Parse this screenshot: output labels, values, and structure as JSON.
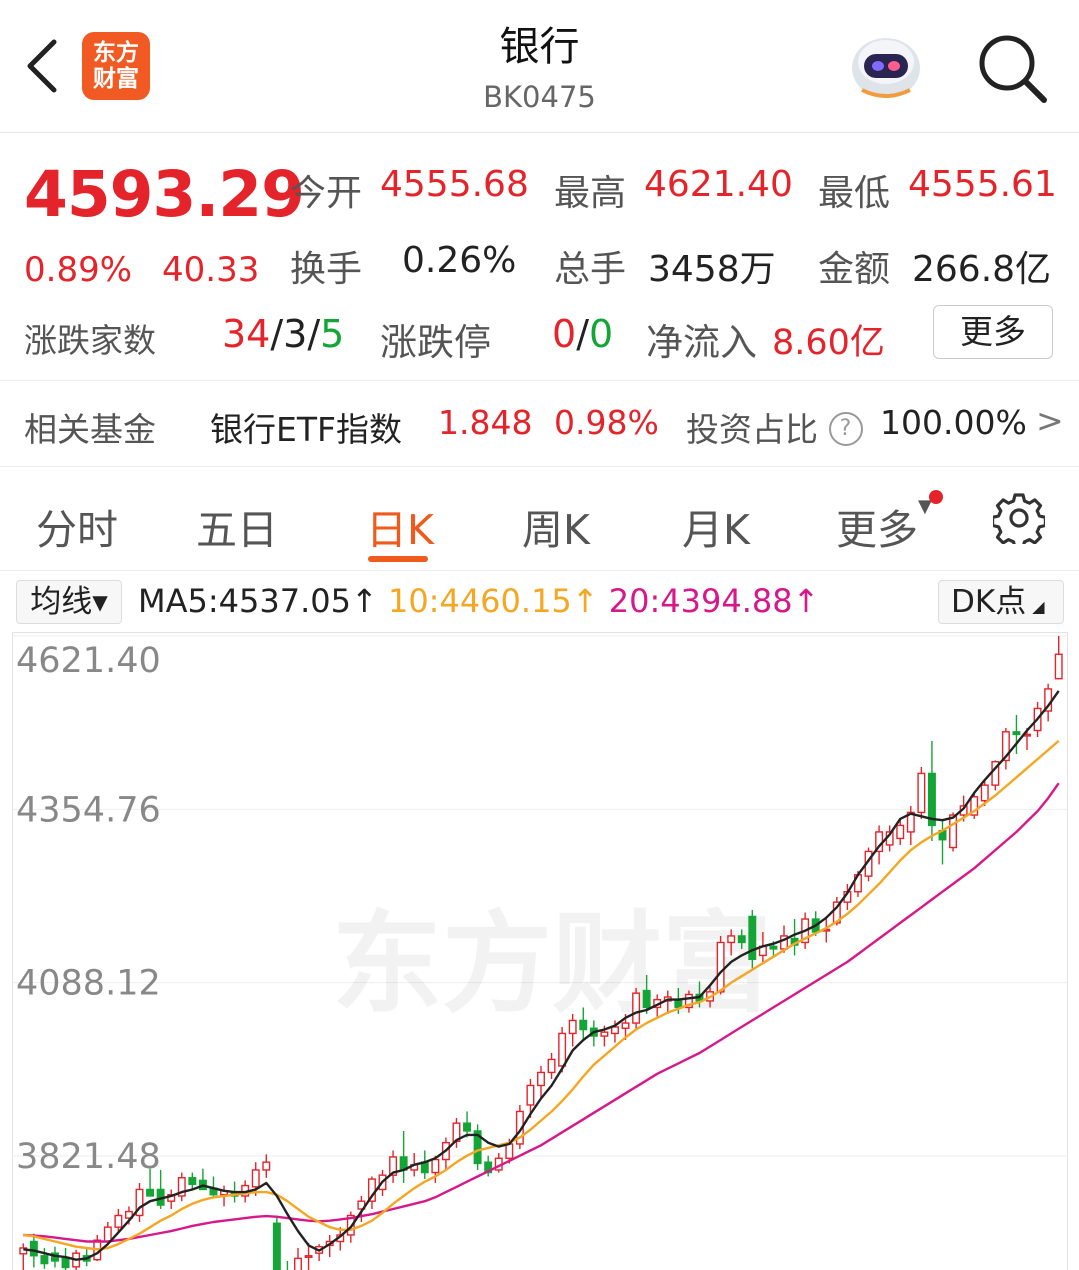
{
  "header": {
    "title": "银行",
    "subtitle": "BK0475",
    "logo_line1": "东方",
    "logo_line2": "财富",
    "icons": [
      "back-icon",
      "robot-avatar-icon",
      "search-icon"
    ]
  },
  "quote": {
    "price": "4593.29",
    "change_pct": "0.89%",
    "change_abs": "40.33",
    "open_label": "今开",
    "open": "4555.68",
    "high_label": "最高",
    "high": "4621.40",
    "low_label": "最低",
    "low": "4555.61",
    "turnover_label": "换手",
    "turnover": "0.26%",
    "volume_label": "总手",
    "volume": "3458万",
    "amount_label": "金额",
    "amount": "266.8亿",
    "breadth_label": "涨跌家数",
    "breadth_up": "34",
    "breadth_flat": "3",
    "breadth_down": "5",
    "slash": "/",
    "limit_label": "涨跌停",
    "limit_up": "0",
    "limit_down": "0",
    "inflow_label": "净流入",
    "inflow": "8.60亿",
    "more_label": "更多"
  },
  "fund": {
    "label": "相关基金",
    "name": "银行ETF指数",
    "value": "1.848",
    "pct": "0.98%",
    "ratio_label": "投资占比",
    "help": "?",
    "ratio": "100.00%",
    "arrow": ">"
  },
  "tabs": [
    {
      "label": "分时"
    },
    {
      "label": "五日"
    },
    {
      "label": "日K"
    },
    {
      "label": "周K"
    },
    {
      "label": "月K"
    },
    {
      "label": "更多"
    }
  ],
  "active_tab": "日K",
  "indicator": {
    "ma_button": "均线▾",
    "ma5": "MA5:4537.05↑",
    "ma10": "10:4460.15↑",
    "ma20": "20:4394.88↑",
    "dk_button": "DK点",
    "colors": {
      "ma5": "#222222",
      "ma10": "#f5a623",
      "ma20": "#d6188a",
      "up": "#e4232a",
      "down": "#14a537"
    }
  },
  "watermark": "东方财富",
  "chart_data": {
    "type": "candlestick",
    "y_ticks": [
      "4621.40",
      "4354.76",
      "4088.12",
      "3821.48"
    ],
    "ylim": [
      3660,
      4621.4
    ],
    "grid": true,
    "candles": [
      {
        "o": 3671,
        "h": 3687,
        "l": 3643,
        "c": 3680
      },
      {
        "o": 3690,
        "h": 3702,
        "l": 3650,
        "c": 3668
      },
      {
        "o": 3668,
        "h": 3680,
        "l": 3648,
        "c": 3656
      },
      {
        "o": 3672,
        "h": 3682,
        "l": 3650,
        "c": 3660
      },
      {
        "o": 3664,
        "h": 3680,
        "l": 3642,
        "c": 3650
      },
      {
        "o": 3651,
        "h": 3677,
        "l": 3644,
        "c": 3672
      },
      {
        "o": 3668,
        "h": 3678,
        "l": 3652,
        "c": 3660
      },
      {
        "o": 3662,
        "h": 3700,
        "l": 3660,
        "c": 3692
      },
      {
        "o": 3690,
        "h": 3720,
        "l": 3684,
        "c": 3712
      },
      {
        "o": 3712,
        "h": 3740,
        "l": 3704,
        "c": 3730
      },
      {
        "o": 3726,
        "h": 3744,
        "l": 3716,
        "c": 3736
      },
      {
        "o": 3730,
        "h": 3780,
        "l": 3720,
        "c": 3770
      },
      {
        "o": 3770,
        "h": 3802,
        "l": 3760,
        "c": 3760
      },
      {
        "o": 3770,
        "h": 3800,
        "l": 3740,
        "c": 3746
      },
      {
        "o": 3752,
        "h": 3770,
        "l": 3740,
        "c": 3762
      },
      {
        "o": 3760,
        "h": 3796,
        "l": 3752,
        "c": 3788
      },
      {
        "o": 3788,
        "h": 3796,
        "l": 3770,
        "c": 3778
      },
      {
        "o": 3784,
        "h": 3802,
        "l": 3772,
        "c": 3770
      },
      {
        "o": 3772,
        "h": 3790,
        "l": 3756,
        "c": 3762
      },
      {
        "o": 3762,
        "h": 3776,
        "l": 3744,
        "c": 3768
      },
      {
        "o": 3766,
        "h": 3782,
        "l": 3750,
        "c": 3760
      },
      {
        "o": 3760,
        "h": 3784,
        "l": 3750,
        "c": 3776
      },
      {
        "o": 3774,
        "h": 3812,
        "l": 3760,
        "c": 3800
      },
      {
        "o": 3800,
        "h": 3824,
        "l": 3788,
        "c": 3812
      },
      {
        "o": 3718,
        "h": 3730,
        "l": 3610,
        "c": 3630
      },
      {
        "o": 3640,
        "h": 3660,
        "l": 3600,
        "c": 3620
      },
      {
        "o": 3630,
        "h": 3680,
        "l": 3630,
        "c": 3664
      },
      {
        "o": 3666,
        "h": 3688,
        "l": 3640,
        "c": 3668
      },
      {
        "o": 3672,
        "h": 3686,
        "l": 3660,
        "c": 3682
      },
      {
        "o": 3684,
        "h": 3700,
        "l": 3666,
        "c": 3690
      },
      {
        "o": 3690,
        "h": 3712,
        "l": 3676,
        "c": 3700
      },
      {
        "o": 3700,
        "h": 3736,
        "l": 3688,
        "c": 3730
      },
      {
        "o": 3740,
        "h": 3760,
        "l": 3720,
        "c": 3752
      },
      {
        "o": 3752,
        "h": 3790,
        "l": 3740,
        "c": 3786
      },
      {
        "o": 3770,
        "h": 3800,
        "l": 3760,
        "c": 3792
      },
      {
        "o": 3792,
        "h": 3830,
        "l": 3780,
        "c": 3820
      },
      {
        "o": 3820,
        "h": 3860,
        "l": 3780,
        "c": 3800
      },
      {
        "o": 3800,
        "h": 3826,
        "l": 3790,
        "c": 3808
      },
      {
        "o": 3812,
        "h": 3830,
        "l": 3786,
        "c": 3796
      },
      {
        "o": 3796,
        "h": 3822,
        "l": 3780,
        "c": 3816
      },
      {
        "o": 3816,
        "h": 3850,
        "l": 3800,
        "c": 3842
      },
      {
        "o": 3844,
        "h": 3880,
        "l": 3834,
        "c": 3872
      },
      {
        "o": 3872,
        "h": 3890,
        "l": 3850,
        "c": 3860
      },
      {
        "o": 3860,
        "h": 3870,
        "l": 3800,
        "c": 3810
      },
      {
        "o": 3812,
        "h": 3822,
        "l": 3790,
        "c": 3796
      },
      {
        "o": 3800,
        "h": 3826,
        "l": 3796,
        "c": 3818
      },
      {
        "o": 3818,
        "h": 3848,
        "l": 3810,
        "c": 3840
      },
      {
        "o": 3840,
        "h": 3900,
        "l": 3832,
        "c": 3890
      },
      {
        "o": 3900,
        "h": 3940,
        "l": 3880,
        "c": 3930
      },
      {
        "o": 3930,
        "h": 3960,
        "l": 3910,
        "c": 3950
      },
      {
        "o": 3950,
        "h": 3980,
        "l": 3940,
        "c": 3970
      },
      {
        "o": 3960,
        "h": 4020,
        "l": 3950,
        "c": 4010
      },
      {
        "o": 4010,
        "h": 4040,
        "l": 3990,
        "c": 4030
      },
      {
        "o": 4030,
        "h": 4050,
        "l": 4000,
        "c": 4016
      },
      {
        "o": 4018,
        "h": 4030,
        "l": 3990,
        "c": 4006
      },
      {
        "o": 4006,
        "h": 4022,
        "l": 3990,
        "c": 4012
      },
      {
        "o": 4010,
        "h": 4030,
        "l": 3996,
        "c": 4020
      },
      {
        "o": 4018,
        "h": 4040,
        "l": 4000,
        "c": 4026
      },
      {
        "o": 4026,
        "h": 4080,
        "l": 4016,
        "c": 4072
      },
      {
        "o": 4076,
        "h": 4100,
        "l": 4040,
        "c": 4050
      },
      {
        "o": 4050,
        "h": 4070,
        "l": 4036,
        "c": 4062
      },
      {
        "o": 4060,
        "h": 4076,
        "l": 4040,
        "c": 4066
      },
      {
        "o": 4060,
        "h": 4080,
        "l": 4040,
        "c": 4050
      },
      {
        "o": 4050,
        "h": 4076,
        "l": 4042,
        "c": 4070
      },
      {
        "o": 4070,
        "h": 4090,
        "l": 4050,
        "c": 4060
      },
      {
        "o": 4060,
        "h": 4082,
        "l": 4050,
        "c": 4074
      },
      {
        "o": 4074,
        "h": 4160,
        "l": 4070,
        "c": 4150
      },
      {
        "o": 4150,
        "h": 4170,
        "l": 4130,
        "c": 4160
      },
      {
        "o": 4160,
        "h": 4170,
        "l": 4140,
        "c": 4150
      },
      {
        "o": 4190,
        "h": 4200,
        "l": 4110,
        "c": 4124
      },
      {
        "o": 4130,
        "h": 4166,
        "l": 4120,
        "c": 4144
      },
      {
        "o": 4144,
        "h": 4152,
        "l": 4126,
        "c": 4140
      },
      {
        "o": 4140,
        "h": 4176,
        "l": 4134,
        "c": 4160
      },
      {
        "o": 4156,
        "h": 4186,
        "l": 4130,
        "c": 4146
      },
      {
        "o": 4150,
        "h": 4196,
        "l": 4140,
        "c": 4186
      },
      {
        "o": 4186,
        "h": 4198,
        "l": 4160,
        "c": 4166
      },
      {
        "o": 4170,
        "h": 4190,
        "l": 4150,
        "c": 4170
      },
      {
        "o": 4180,
        "h": 4220,
        "l": 4176,
        "c": 4212
      },
      {
        "o": 4212,
        "h": 4240,
        "l": 4200,
        "c": 4228
      },
      {
        "o": 4228,
        "h": 4260,
        "l": 4220,
        "c": 4254
      },
      {
        "o": 4252,
        "h": 4296,
        "l": 4244,
        "c": 4290
      },
      {
        "o": 4290,
        "h": 4330,
        "l": 4270,
        "c": 4320
      },
      {
        "o": 4300,
        "h": 4330,
        "l": 4290,
        "c": 4320
      },
      {
        "o": 4310,
        "h": 4340,
        "l": 4300,
        "c": 4330
      },
      {
        "o": 4320,
        "h": 4360,
        "l": 4300,
        "c": 4350
      },
      {
        "o": 4350,
        "h": 4420,
        "l": 4340,
        "c": 4410
      },
      {
        "o": 4410,
        "h": 4460,
        "l": 4306,
        "c": 4330
      },
      {
        "o": 4322,
        "h": 4340,
        "l": 4270,
        "c": 4308
      },
      {
        "o": 4296,
        "h": 4350,
        "l": 4290,
        "c": 4346
      },
      {
        "o": 4346,
        "h": 4376,
        "l": 4336,
        "c": 4360
      },
      {
        "o": 4346,
        "h": 4380,
        "l": 4340,
        "c": 4374
      },
      {
        "o": 4368,
        "h": 4400,
        "l": 4360,
        "c": 4392
      },
      {
        "o": 4392,
        "h": 4430,
        "l": 4384,
        "c": 4428
      },
      {
        "o": 4430,
        "h": 4480,
        "l": 4416,
        "c": 4474
      },
      {
        "o": 4474,
        "h": 4500,
        "l": 4440,
        "c": 4470
      },
      {
        "o": 4470,
        "h": 4480,
        "l": 4446,
        "c": 4470
      },
      {
        "o": 4476,
        "h": 4520,
        "l": 4466,
        "c": 4510
      },
      {
        "o": 4506,
        "h": 4548,
        "l": 4490,
        "c": 4540
      },
      {
        "o": 4555.68,
        "h": 4621.4,
        "l": 4555.61,
        "c": 4593.29
      }
    ],
    "ma5": [
      3678,
      3676,
      3672,
      3668,
      3666,
      3662,
      3664,
      3672,
      3686,
      3704,
      3722,
      3742,
      3752,
      3756,
      3760,
      3766,
      3770,
      3776,
      3772,
      3768,
      3766,
      3766,
      3770,
      3780,
      3760,
      3732,
      3706,
      3684,
      3676,
      3686,
      3698,
      3712,
      3736,
      3760,
      3782,
      3796,
      3800,
      3808,
      3812,
      3818,
      3830,
      3846,
      3854,
      3854,
      3842,
      3836,
      3840,
      3860,
      3886,
      3910,
      3930,
      3956,
      3984,
      4000,
      4012,
      4016,
      4022,
      4034,
      4042,
      4046,
      4054,
      4062,
      4062,
      4064,
      4066,
      4084,
      4104,
      4120,
      4130,
      4138,
      4144,
      4148,
      4154,
      4162,
      4168,
      4176,
      4188,
      4204,
      4226,
      4254,
      4276,
      4298,
      4316,
      4340,
      4348,
      4344,
      4340,
      4338,
      4342,
      4356,
      4380,
      4400,
      4418,
      4436,
      4456,
      4476,
      4494,
      4514,
      4537
    ],
    "ma10": [
      3700,
      3698,
      3694,
      3690,
      3686,
      3682,
      3680,
      3678,
      3680,
      3686,
      3694,
      3702,
      3712,
      3722,
      3730,
      3740,
      3748,
      3754,
      3758,
      3760,
      3762,
      3764,
      3766,
      3766,
      3762,
      3752,
      3740,
      3728,
      3720,
      3712,
      3708,
      3708,
      3714,
      3722,
      3734,
      3748,
      3760,
      3772,
      3782,
      3790,
      3800,
      3812,
      3822,
      3830,
      3834,
      3838,
      3842,
      3850,
      3862,
      3876,
      3890,
      3906,
      3924,
      3944,
      3962,
      3976,
      3990,
      4004,
      4016,
      4026,
      4034,
      4042,
      4048,
      4054,
      4058,
      4066,
      4076,
      4088,
      4098,
      4108,
      4118,
      4128,
      4138,
      4148,
      4156,
      4164,
      4172,
      4182,
      4194,
      4208,
      4224,
      4240,
      4258,
      4276,
      4292,
      4304,
      4314,
      4322,
      4332,
      4342,
      4352,
      4364,
      4376,
      4390,
      4404,
      4418,
      4432,
      4446,
      4460
    ],
    "ma20": [
      3700,
      3699,
      3698,
      3696,
      3694,
      3692,
      3690,
      3690,
      3690,
      3692,
      3694,
      3697,
      3700,
      3703,
      3706,
      3710,
      3714,
      3717,
      3720,
      3722,
      3724,
      3726,
      3728,
      3729,
      3728,
      3726,
      3724,
      3722,
      3721,
      3722,
      3724,
      3726,
      3729,
      3732,
      3736,
      3740,
      3744,
      3748,
      3752,
      3758,
      3766,
      3774,
      3782,
      3790,
      3798,
      3806,
      3814,
      3822,
      3830,
      3838,
      3848,
      3858,
      3868,
      3878,
      3888,
      3898,
      3908,
      3918,
      3928,
      3938,
      3948,
      3956,
      3964,
      3972,
      3980,
      3990,
      4000,
      4010,
      4020,
      4030,
      4040,
      4050,
      4060,
      4070,
      4080,
      4090,
      4100,
      4110,
      4120,
      4132,
      4144,
      4156,
      4168,
      4180,
      4192,
      4204,
      4216,
      4228,
      4240,
      4252,
      4264,
      4278,
      4292,
      4306,
      4320,
      4336,
      4352,
      4372,
      4395
    ]
  }
}
